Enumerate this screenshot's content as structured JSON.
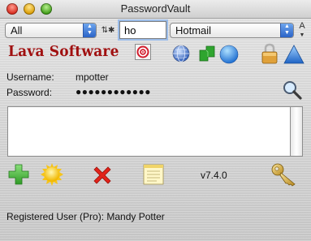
{
  "window": {
    "title": "PasswordVault"
  },
  "toolbar": {
    "category_select": "All",
    "sort_glyph": "⇅✱",
    "search_value": "ho",
    "account_select": "Hotmail",
    "font_glyph": "A"
  },
  "brand": {
    "logo_text": "Lava Software"
  },
  "credentials": {
    "username_label": "Username:",
    "username_value": "mpotter",
    "password_label": "Password:",
    "password_value": "●●●●●●●●●●●●"
  },
  "notes": {
    "text": ""
  },
  "footer": {
    "version": "v7.4.0",
    "registration": "Registered User (Pro): Mandy Potter"
  },
  "icons": {
    "target": "target-icon",
    "globe": "globe-icon",
    "green_box": "green-box-icon",
    "blue_circle": "blue-circle-icon",
    "lock": "lock-icon",
    "triangle": "triangle-icon",
    "magnifier": "magnifier-icon",
    "add": "add-icon",
    "sun": "sun-icon",
    "delete": "delete-icon",
    "note": "note-icon",
    "key": "key-icon"
  },
  "colors": {
    "logo_red": "#a01010",
    "select_blue": "#2a63c7",
    "focus_ring": "#9bbce8"
  }
}
